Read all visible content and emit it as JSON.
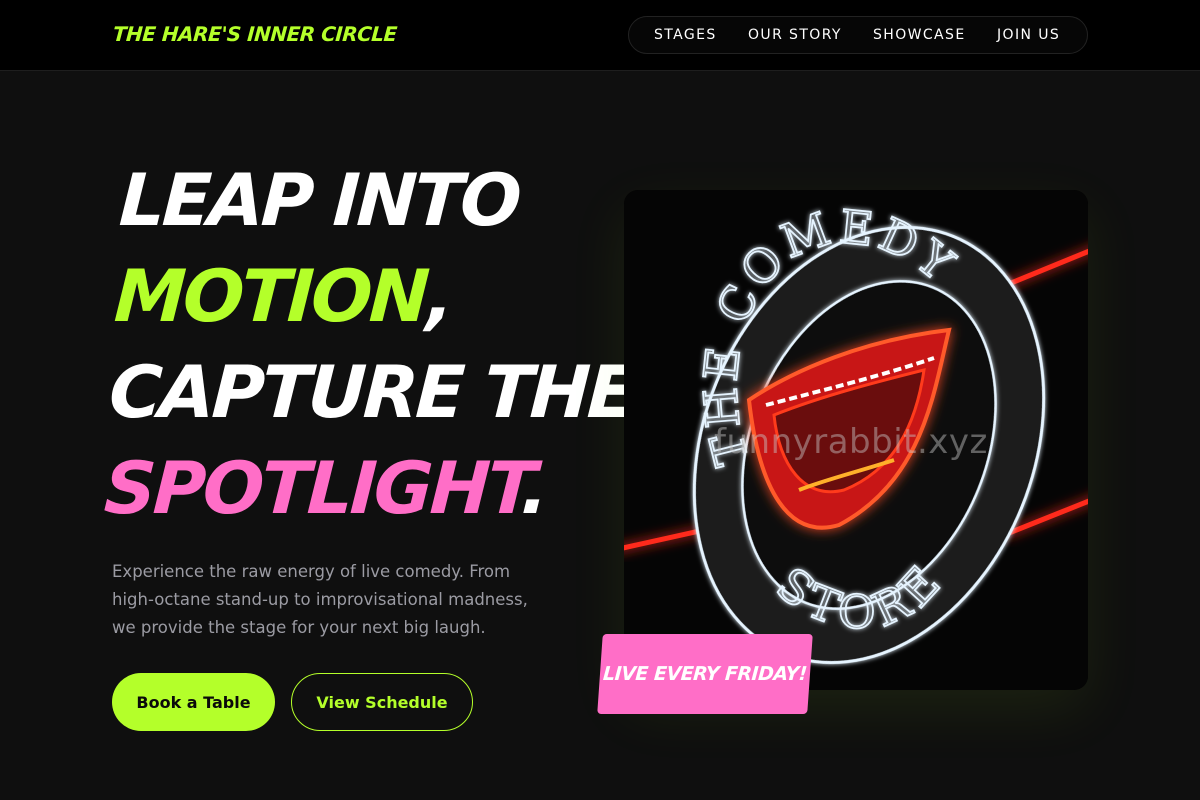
{
  "brand": {
    "name": "THE HARE'S INNER CIRCLE"
  },
  "nav": {
    "items": [
      {
        "label": "STAGES"
      },
      {
        "label": "OUR STORY"
      },
      {
        "label": "SHOWCASE"
      },
      {
        "label": "JOIN US"
      }
    ]
  },
  "hero": {
    "headline": {
      "part1": "LEAP INTO",
      "part2": "MOTION",
      "part3": ",",
      "part4": "CAPTURE THE",
      "part5": "SPOTLIGHT",
      "part6": "."
    },
    "lead": "Experience the raw energy of live comedy. From high-octane stand-up to improvisational madness, we provide the stage for your next big laugh.",
    "primary_cta": "Book a Table",
    "secondary_cta": "View Schedule"
  },
  "feature_image": {
    "sign_text_top": "THE COMEDY",
    "sign_text_bottom": "STORE",
    "watermark": "funnyrabbit.xyz",
    "badge": "LIVE EVERY FRIDAY!"
  },
  "colors": {
    "accent_green": "#b4ff2a",
    "accent_pink": "#ff6ec7",
    "background": "#0f0f0f"
  }
}
